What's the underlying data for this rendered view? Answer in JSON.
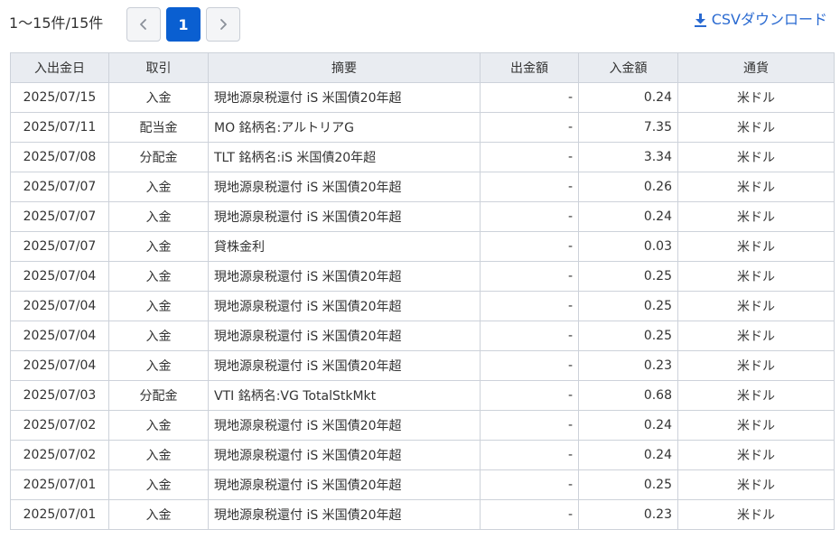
{
  "result_count": "1〜15件/15件",
  "pagination": {
    "prev_icon": "chevron-left-icon",
    "current_page": "1",
    "next_icon": "chevron-right-icon"
  },
  "csv_download": {
    "label": "CSVダウンロード",
    "icon": "download-icon"
  },
  "colors": {
    "accent": "#0a5fd1",
    "link": "#2a6ad1",
    "header_bg": "#e9ecf1",
    "border": "#cdd2da"
  },
  "table": {
    "columns": [
      "入出金日",
      "取引",
      "摘要",
      "出金額",
      "入金額",
      "通貨"
    ],
    "rows": [
      {
        "date": "2025/07/15",
        "type": "入金",
        "description": "現地源泉税還付 iS 米国債20年超",
        "withdrawal": "-",
        "deposit": "0.24",
        "currency": "米ドル"
      },
      {
        "date": "2025/07/11",
        "type": "配当金",
        "description": "MO 銘柄名:アルトリアG",
        "withdrawal": "-",
        "deposit": "7.35",
        "currency": "米ドル"
      },
      {
        "date": "2025/07/08",
        "type": "分配金",
        "description": "TLT 銘柄名:iS 米国債20年超",
        "withdrawal": "-",
        "deposit": "3.34",
        "currency": "米ドル"
      },
      {
        "date": "2025/07/07",
        "type": "入金",
        "description": "現地源泉税還付 iS 米国債20年超",
        "withdrawal": "-",
        "deposit": "0.26",
        "currency": "米ドル"
      },
      {
        "date": "2025/07/07",
        "type": "入金",
        "description": "現地源泉税還付 iS 米国債20年超",
        "withdrawal": "-",
        "deposit": "0.24",
        "currency": "米ドル"
      },
      {
        "date": "2025/07/07",
        "type": "入金",
        "description": "貸株金利",
        "withdrawal": "-",
        "deposit": "0.03",
        "currency": "米ドル"
      },
      {
        "date": "2025/07/04",
        "type": "入金",
        "description": "現地源泉税還付 iS 米国債20年超",
        "withdrawal": "-",
        "deposit": "0.25",
        "currency": "米ドル"
      },
      {
        "date": "2025/07/04",
        "type": "入金",
        "description": "現地源泉税還付 iS 米国債20年超",
        "withdrawal": "-",
        "deposit": "0.25",
        "currency": "米ドル"
      },
      {
        "date": "2025/07/04",
        "type": "入金",
        "description": "現地源泉税還付 iS 米国債20年超",
        "withdrawal": "-",
        "deposit": "0.25",
        "currency": "米ドル"
      },
      {
        "date": "2025/07/04",
        "type": "入金",
        "description": "現地源泉税還付 iS 米国債20年超",
        "withdrawal": "-",
        "deposit": "0.23",
        "currency": "米ドル"
      },
      {
        "date": "2025/07/03",
        "type": "分配金",
        "description": "VTI 銘柄名:VG TotalStkMkt",
        "withdrawal": "-",
        "deposit": "0.68",
        "currency": "米ドル"
      },
      {
        "date": "2025/07/02",
        "type": "入金",
        "description": "現地源泉税還付 iS 米国債20年超",
        "withdrawal": "-",
        "deposit": "0.24",
        "currency": "米ドル"
      },
      {
        "date": "2025/07/02",
        "type": "入金",
        "description": "現地源泉税還付 iS 米国債20年超",
        "withdrawal": "-",
        "deposit": "0.24",
        "currency": "米ドル"
      },
      {
        "date": "2025/07/01",
        "type": "入金",
        "description": "現地源泉税還付 iS 米国債20年超",
        "withdrawal": "-",
        "deposit": "0.25",
        "currency": "米ドル"
      },
      {
        "date": "2025/07/01",
        "type": "入金",
        "description": "現地源泉税還付 iS 米国債20年超",
        "withdrawal": "-",
        "deposit": "0.23",
        "currency": "米ドル"
      }
    ]
  }
}
